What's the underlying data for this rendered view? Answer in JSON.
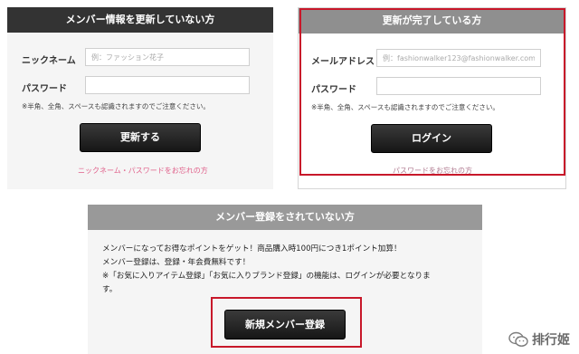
{
  "panel_update_not_done": {
    "header": "メンバー情報を更新していない方",
    "nickname_label": "ニックネーム",
    "nickname_placeholder": "例：ファッション花子",
    "password_label": "パスワード",
    "password_value": "",
    "note": "※半角、全角、スペースも認識されますのでご注意ください。",
    "button_label": "更新する",
    "forgot_link": "ニックネーム・パスワードをお忘れの方"
  },
  "panel_update_done": {
    "header": "更新が完了している方",
    "email_label": "メールアドレス",
    "email_placeholder": "例：fashionwalker123@fashionwalker.com",
    "password_label": "パスワード",
    "password_value": "",
    "note": "※半角、全角、スペースも認識されますのでご注意ください。",
    "button_label": "ログイン",
    "forgot_link": "パスワードをお忘れの方"
  },
  "panel_not_registered": {
    "header": "メンバー登録をされていない方",
    "lines": [
      "メンバーになってお得なポイントをゲット！商品購入時100円につき1ポイント加算！",
      "メンバー登録は、登録・年会費無料です！",
      "※「お気に入りアイテム登録」「お気に入りブランド登録」の機能は、ログインが必要となりま",
      "す。"
    ],
    "button_label": "新規メンバー登録"
  },
  "watermark": {
    "text": "排行姬",
    "icon": "wechat-icon"
  },
  "colors": {
    "dark_header": "#333333",
    "gray_header": "#999999",
    "highlight_red": "#c8182a",
    "link_pink": "#e0608a"
  }
}
